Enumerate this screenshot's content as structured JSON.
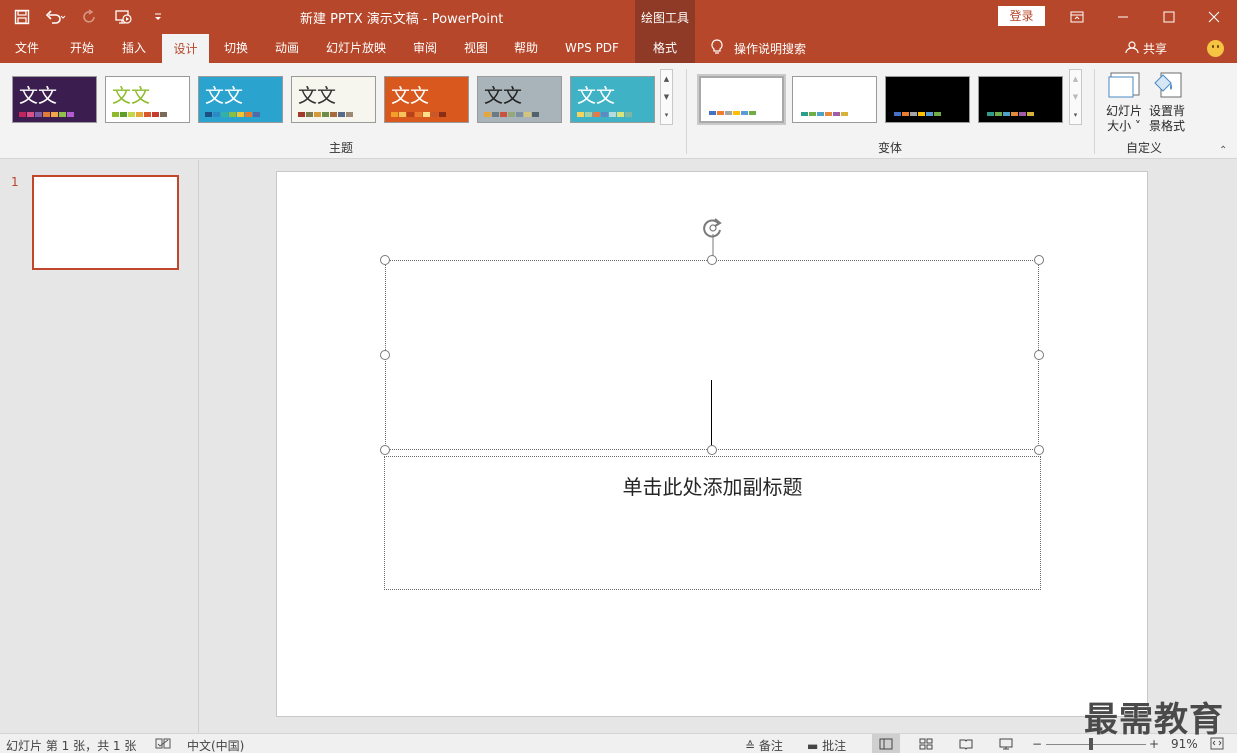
{
  "window": {
    "title": "新建 PPTX 演示文稿  -  PowerPoint",
    "context_tools": "绘图工具",
    "login": "登录"
  },
  "tabs": [
    {
      "label": "文件"
    },
    {
      "label": "开始"
    },
    {
      "label": "插入"
    },
    {
      "label": "设计"
    },
    {
      "label": "切换"
    },
    {
      "label": "动画"
    },
    {
      "label": "幻灯片放映"
    },
    {
      "label": "审阅"
    },
    {
      "label": "视图"
    },
    {
      "label": "帮助"
    },
    {
      "label": "WPS PDF"
    },
    {
      "label": "格式"
    }
  ],
  "active_tab": "设计",
  "tell_me": "操作说明搜索",
  "share": "共享",
  "ribbon": {
    "themes_group": "主题",
    "variants_group": "变体",
    "customize_group": "自定义",
    "theme_text": "文文",
    "themes": [
      {
        "bg": "#3b1e4f",
        "fg": "#ffffff",
        "swatches": [
          "#c0245c",
          "#d9508a",
          "#7a5ca8",
          "#e07b3a",
          "#f1a64c",
          "#8fc04a",
          "#b35bd0"
        ]
      },
      {
        "bg": "#ffffff",
        "fg": "#8dbb2b",
        "swatches": [
          "#8dbb2b",
          "#5f9e2a",
          "#c6d64a",
          "#e8a93a",
          "#d9572b",
          "#c8392f",
          "#7a6a5a"
        ]
      },
      {
        "bg": "#2aa3cf",
        "fg": "#ffffff",
        "swatches": [
          "#1c4f83",
          "#2f89c6",
          "#35b0a6",
          "#86bf43",
          "#f1c232",
          "#e57b2b",
          "#4f6aa8"
        ]
      },
      {
        "bg": "#f7f6ee",
        "fg": "#333333",
        "swatches": [
          "#a23c2a",
          "#7b7b4e",
          "#d39b3b",
          "#6d8d4c",
          "#a86a3c",
          "#5a6b8a",
          "#9c8a74"
        ]
      },
      {
        "bg": "#d8581e",
        "fg": "#ffffff",
        "swatches": [
          "#f2a02c",
          "#f7c45c",
          "#b8411b",
          "#e97b2e",
          "#ffe08a",
          "#c9572a",
          "#8a2f16"
        ]
      },
      {
        "bg": "#a9b4ba",
        "fg": "#222222",
        "swatches": [
          "#e4a73d",
          "#6b7b85",
          "#c9533e",
          "#93a87b",
          "#7d8fa2",
          "#d4c37a",
          "#52626a"
        ]
      },
      {
        "bg": "#3fb2c6",
        "fg": "#ffffff",
        "swatches": [
          "#f4d35e",
          "#9fd0a9",
          "#e6794a",
          "#5c8ac2",
          "#b4dbe0",
          "#d7e37e",
          "#7fb6a1"
        ]
      }
    ],
    "variants": [
      {
        "bg": "#ffffff",
        "swatches": [
          "#4472c4",
          "#ed7d31",
          "#a5a5a5",
          "#ffc000",
          "#5b9bd5",
          "#70ad47"
        ]
      },
      {
        "bg": "#ffffff",
        "swatches": [
          "#2e9e8b",
          "#70ad47",
          "#4ea1c7",
          "#e58a3a",
          "#a05ea8",
          "#d6b23a"
        ]
      },
      {
        "bg": "#000000",
        "swatches": [
          "#4472c4",
          "#ed7d31",
          "#a5a5a5",
          "#ffc000",
          "#5b9bd5",
          "#70ad47"
        ]
      },
      {
        "bg": "#000000",
        "swatches": [
          "#2e9e8b",
          "#70ad47",
          "#4ea1c7",
          "#e58a3a",
          "#a05ea8",
          "#d6b23a"
        ]
      }
    ],
    "slide_size_line1": "幻灯片",
    "slide_size_line2": "大小 ˅",
    "format_bg_line1": "设置背",
    "format_bg_line2": "景格式"
  },
  "slides_pane": {
    "slide_number": "1"
  },
  "slide": {
    "subtitle_placeholder": "单击此处添加副标题"
  },
  "statusbar": {
    "slide_info": "幻灯片 第 1 张，共 1 张",
    "language": "中文(中国)",
    "notes": "备注",
    "comments": "批注",
    "zoom_minus": "−",
    "zoom_plus": "+",
    "zoom": "91%",
    "zoom_fraction": 0.91
  },
  "watermark": "最需教育"
}
